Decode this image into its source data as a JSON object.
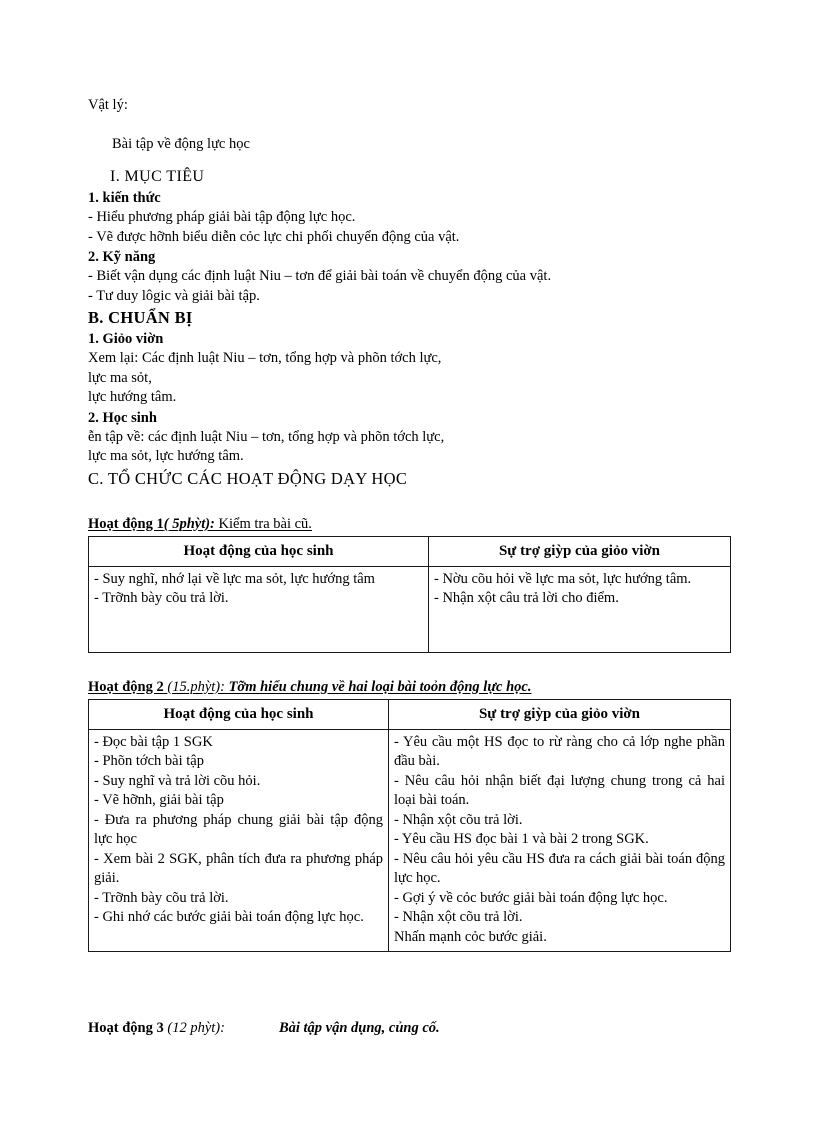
{
  "document": {
    "subject": "Vật lý:",
    "lesson_title": "Bài tập về động lực học",
    "section_i": "I.  MỤC TIÊU",
    "h_1_kien_thuc": "1. kiến thức",
    "kien_thuc_items": [
      "- Hiểu phương pháp giải bài tập động lực học.",
      "- Vẽ được hỡnh biểu diễn cỏc lực chi phối chuyển động của vật."
    ],
    "h_2_ky_nang": "2. Kỹ năng",
    "ky_nang_items": [
      "- Biết vận dụng các định luật Niu – tơn để giải bài toán về chuyển động của vật.",
      "- Tư duy lôgic  và giải bài tập."
    ],
    "section_b": "B. CHUẨN BỊ",
    "h_b1": "1. Giỏo viờn",
    "b1_lines": [
      "Xem lại:  Các định luật Niu – tơn, tổng hợp và phõn tớch lực,",
      " lực ma sỏt,",
      " lực hướng tâm."
    ],
    "h_b2": "2. Học sinh",
    "b2_lines": [
      "ễn tập về: các định luật Niu – tơn, tổng hợp và phõn tớch lực,",
      "lực ma sỏt, lực hướng tâm."
    ],
    "section_c": "C. TỔ CHỨC CÁC HOẠT ĐỘNG DẠY HỌC"
  },
  "activity1": {
    "label": "Hoạt động 1",
    "minutes": "( 5phỳt):",
    "description": "Kiểm tra bài cũ.",
    "table": {
      "headers": [
        "Hoạt động của học sinh",
        "Sự trợ giỳp của giỏo viờn"
      ],
      "left_items": [
        "- Suy nghĩ,  nhớ lại về lực ma sỏt, lực hướng tâm",
        "- Trỡnh bày cõu trả lời."
      ],
      "right_items": [
        "- Nờu cõu hỏi về lực ma sỏt, lực hướng tâm.",
        "- Nhận xột câu trả lời cho điểm."
      ]
    }
  },
  "activity2": {
    "label": "Hoạt động 2",
    "minutes": "(15.phỳt):",
    "description": "Tỡm hiểu chung về hai loại bài toỏn động lực học.",
    "table": {
      "headers": [
        "Hoạt động của học sinh",
        "Sự trợ giỳp của giỏo viờn"
      ],
      "left_items": [
        "- Đọc bài tập 1 SGK",
        "- Phõn tớch bài tập",
        "- Suy nghĩ và trả lời cõu hỏi.",
        "- Vẽ hỡnh, giải bài tập",
        "- Đưa ra phương pháp chung giải bài tập động lực học",
        "- Xem bài 2 SGK, phân tích  đưa ra phương pháp giải.",
        "- Trỡnh bày cõu trả lời.",
        "- Ghi nhớ các bước giải  bài toán động lực học."
      ],
      "right_items": [
        "- Yêu cầu một HS đọc to rừ ràng cho cả lớp nghe phần đầu bài.",
        "- Nêu câu hỏi  nhận biết đại lượng chung trong cả hai loại bài toán.",
        "- Nhận xột cõu trả lời.",
        "- Yêu cầu HS đọc bài 1 và bài 2 trong SGK.",
        "- Nêu câu hỏi yêu cầu HS đưa ra cách giải bài toán động lực học.",
        "- Gợi ý về cỏc bước giải  bài toán động lực học.",
        "- Nhận xột cõu trả lời.",
        " Nhấn mạnh  cỏc bước giải."
      ]
    }
  },
  "activity3": {
    "label": "Hoạt động 3",
    "minutes": "(12 phỳt):",
    "description": "Bài tập vận dụng, củng cố."
  }
}
